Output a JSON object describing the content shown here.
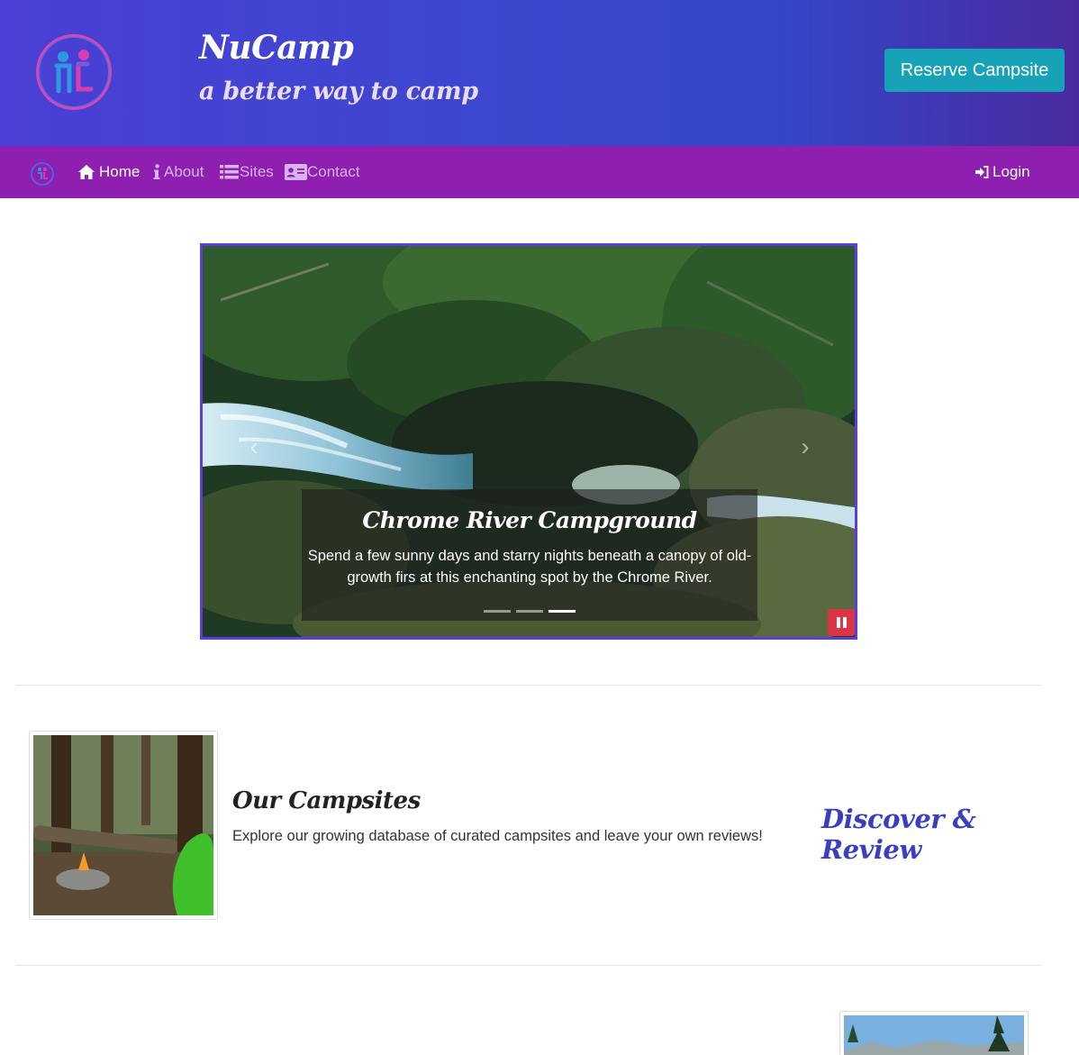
{
  "header": {
    "brand_title": "NuCamp",
    "tagline": "a better way to camp",
    "reserve_label": "Reserve Campsite"
  },
  "navbar": {
    "items": [
      {
        "label": "Home",
        "icon": "home-icon",
        "active": true
      },
      {
        "label": "About",
        "icon": "info-icon",
        "active": false
      },
      {
        "label": "Sites",
        "icon": "list-icon",
        "active": false
      },
      {
        "label": "Contact",
        "icon": "address-card-icon",
        "active": false
      }
    ],
    "login_label": "Login"
  },
  "carousel": {
    "caption_title": "Chrome River Campground",
    "caption_text": "Spend a few sunny days and starry nights beneath a canopy of old-growth firs at this enchanting spot by the Chrome River.",
    "slide_count": 3,
    "active_slide": 3
  },
  "campsites": {
    "title": "Our Campsites",
    "text": "Explore our growing database of curated campsites and leave your own reviews!",
    "tagline": "Discover & Review"
  },
  "colors": {
    "header_gradient_start": "#4a3fd6",
    "navbar": "#8e1fb0",
    "reserve_button": "#17a2b8",
    "carousel_border": "#5b3fd8",
    "pause_button": "#dc3545",
    "discover_text": "#3b3fbf"
  }
}
